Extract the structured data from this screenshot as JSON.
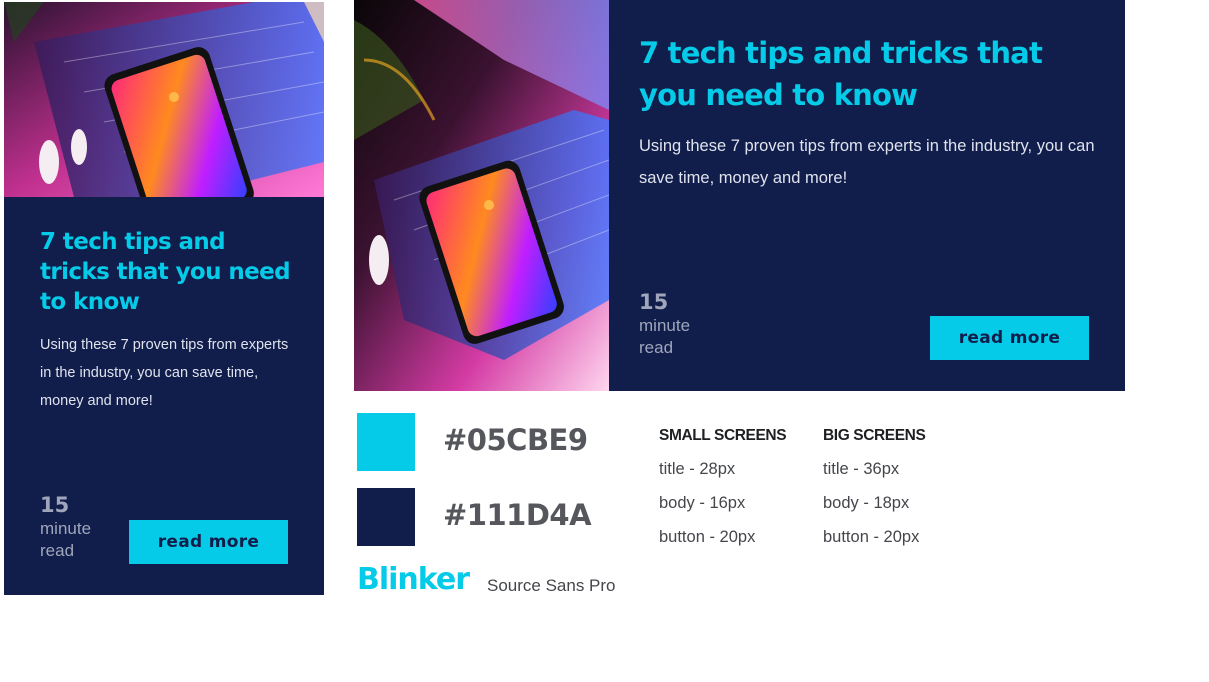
{
  "colors": {
    "accent": "#05CBE9",
    "primary": "#111D4A"
  },
  "card_small": {
    "image": "laptop-and-smartphone-photo",
    "title": "7 tech tips and tricks that you need to know",
    "body": "Using these 7 proven tips from experts in the industry, you can save time, money and more!",
    "read_number": "15",
    "read_word1": "minute",
    "read_word2": "read",
    "button_label": "read more"
  },
  "card_large": {
    "image": "laptop-and-smartphone-photo",
    "title": "7 tech tips and tricks that you need to know",
    "body": "Using these 7 proven tips from experts in the industry, you can save time, money and more!",
    "read_number": "15",
    "read_word1": "minute",
    "read_word2": "read",
    "button_label": "read more"
  },
  "style_guide": {
    "swatches": [
      {
        "hex": "#05CBE9"
      },
      {
        "hex": "#111D4A"
      }
    ],
    "fonts": {
      "heading": "Blinker",
      "body": "Source Sans Pro"
    },
    "small_screens": {
      "heading": "SMALL SCREENS",
      "rows": [
        "title - 28px",
        "body - 16px",
        "button - 20px"
      ]
    },
    "big_screens": {
      "heading": "BIG SCREENS",
      "rows": [
        "title - 36px",
        "body - 18px",
        "button - 20px"
      ]
    }
  }
}
